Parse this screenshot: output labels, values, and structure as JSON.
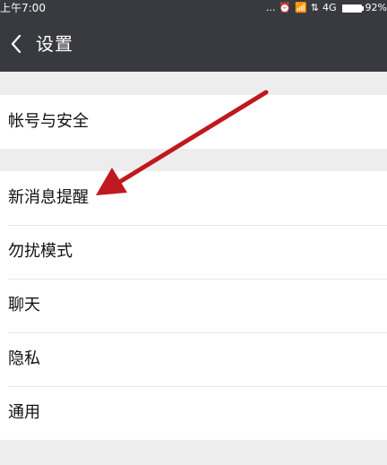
{
  "status_bar": {
    "time": "上午7:00",
    "dots": "...",
    "network": "4G",
    "battery": "92%"
  },
  "header": {
    "title": "设置"
  },
  "groups": [
    {
      "items": [
        "帐号与安全"
      ]
    },
    {
      "items": [
        "新消息提醒",
        "勿扰模式",
        "聊天",
        "隐私",
        "通用"
      ]
    }
  ],
  "annotation": {
    "color": "#c0181f"
  }
}
